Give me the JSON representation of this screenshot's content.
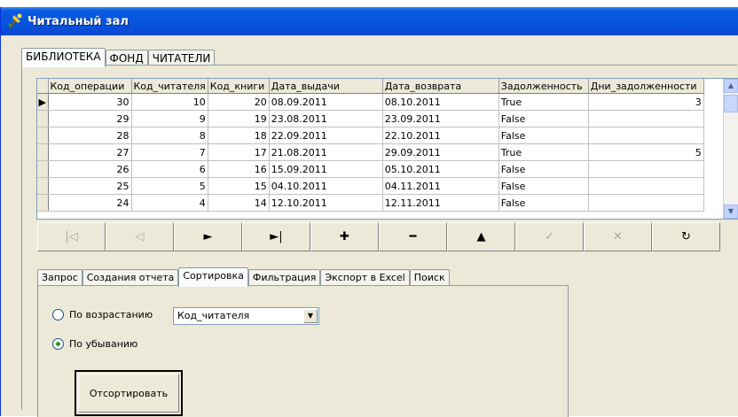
{
  "window": {
    "title": "Читальный зал"
  },
  "top_tabs": [
    "БИБЛИОТЕКА",
    "ФОНД",
    "ЧИТАТЕЛИ"
  ],
  "grid": {
    "columns": [
      "Код_операции",
      "Код_читателя",
      "Код_книги",
      "Дата_выдачи",
      "Дата_возврата",
      "Задолженность",
      "Дни_задолженности"
    ],
    "rows": [
      [
        "30",
        "10",
        "20",
        "08.09.2011",
        "08.10.2011",
        "True",
        "3"
      ],
      [
        "29",
        "9",
        "19",
        "23.08.2011",
        "23.09.2011",
        "False",
        ""
      ],
      [
        "28",
        "8",
        "18",
        "22.09.2011",
        "22.10.2011",
        "False",
        ""
      ],
      [
        "27",
        "7",
        "17",
        "21.08.2011",
        "29.09.2011",
        "True",
        "5"
      ],
      [
        "26",
        "6",
        "16",
        "15.09.2011",
        "05.10.2011",
        "False",
        ""
      ],
      [
        "25",
        "5",
        "15",
        "04.10.2011",
        "04.11.2011",
        "False",
        ""
      ],
      [
        "24",
        "4",
        "14",
        "12.10.2011",
        "12.11.2011",
        "False",
        ""
      ]
    ],
    "current_row": 0
  },
  "navigator": [
    {
      "name": "nav-first-button",
      "icon": "first-record-icon",
      "glyph": "|◁",
      "enabled": false
    },
    {
      "name": "nav-prior-button",
      "icon": "prior-record-icon",
      "glyph": "◁",
      "enabled": false
    },
    {
      "name": "nav-next-button",
      "icon": "next-record-icon",
      "glyph": "►",
      "enabled": true
    },
    {
      "name": "nav-last-button",
      "icon": "last-record-icon",
      "glyph": "►|",
      "enabled": true
    },
    {
      "name": "nav-insert-button",
      "icon": "plus-icon",
      "glyph": "✚",
      "enabled": true
    },
    {
      "name": "nav-delete-button",
      "icon": "minus-icon",
      "glyph": "━",
      "enabled": true
    },
    {
      "name": "nav-edit-button",
      "icon": "edit-triangle-icon",
      "glyph": "▲",
      "enabled": true
    },
    {
      "name": "nav-post-button",
      "icon": "checkmark-icon",
      "glyph": "✓",
      "enabled": false
    },
    {
      "name": "nav-cancel-button",
      "icon": "cancel-x-icon",
      "glyph": "✕",
      "enabled": false
    },
    {
      "name": "nav-refresh-button",
      "icon": "refresh-icon",
      "glyph": "↻",
      "enabled": true
    }
  ],
  "inner_tabs": [
    "Запрос",
    "Создания отчета",
    "Сортировка",
    "Фильтрация",
    "Экспорт в Excel",
    "Поиск"
  ],
  "inner_tabs_active": 2,
  "sort": {
    "ascending_label": "По возрастанию",
    "descending_label": "По убыванию",
    "selected_order": "descending",
    "field_value": "Код_читателя",
    "button_label": "Отсортировать"
  },
  "colors": {
    "titlebar": "#0654e0",
    "face": "#ece9d8",
    "grid_border": "#7f9db9",
    "radio_dot": "#21a121"
  }
}
